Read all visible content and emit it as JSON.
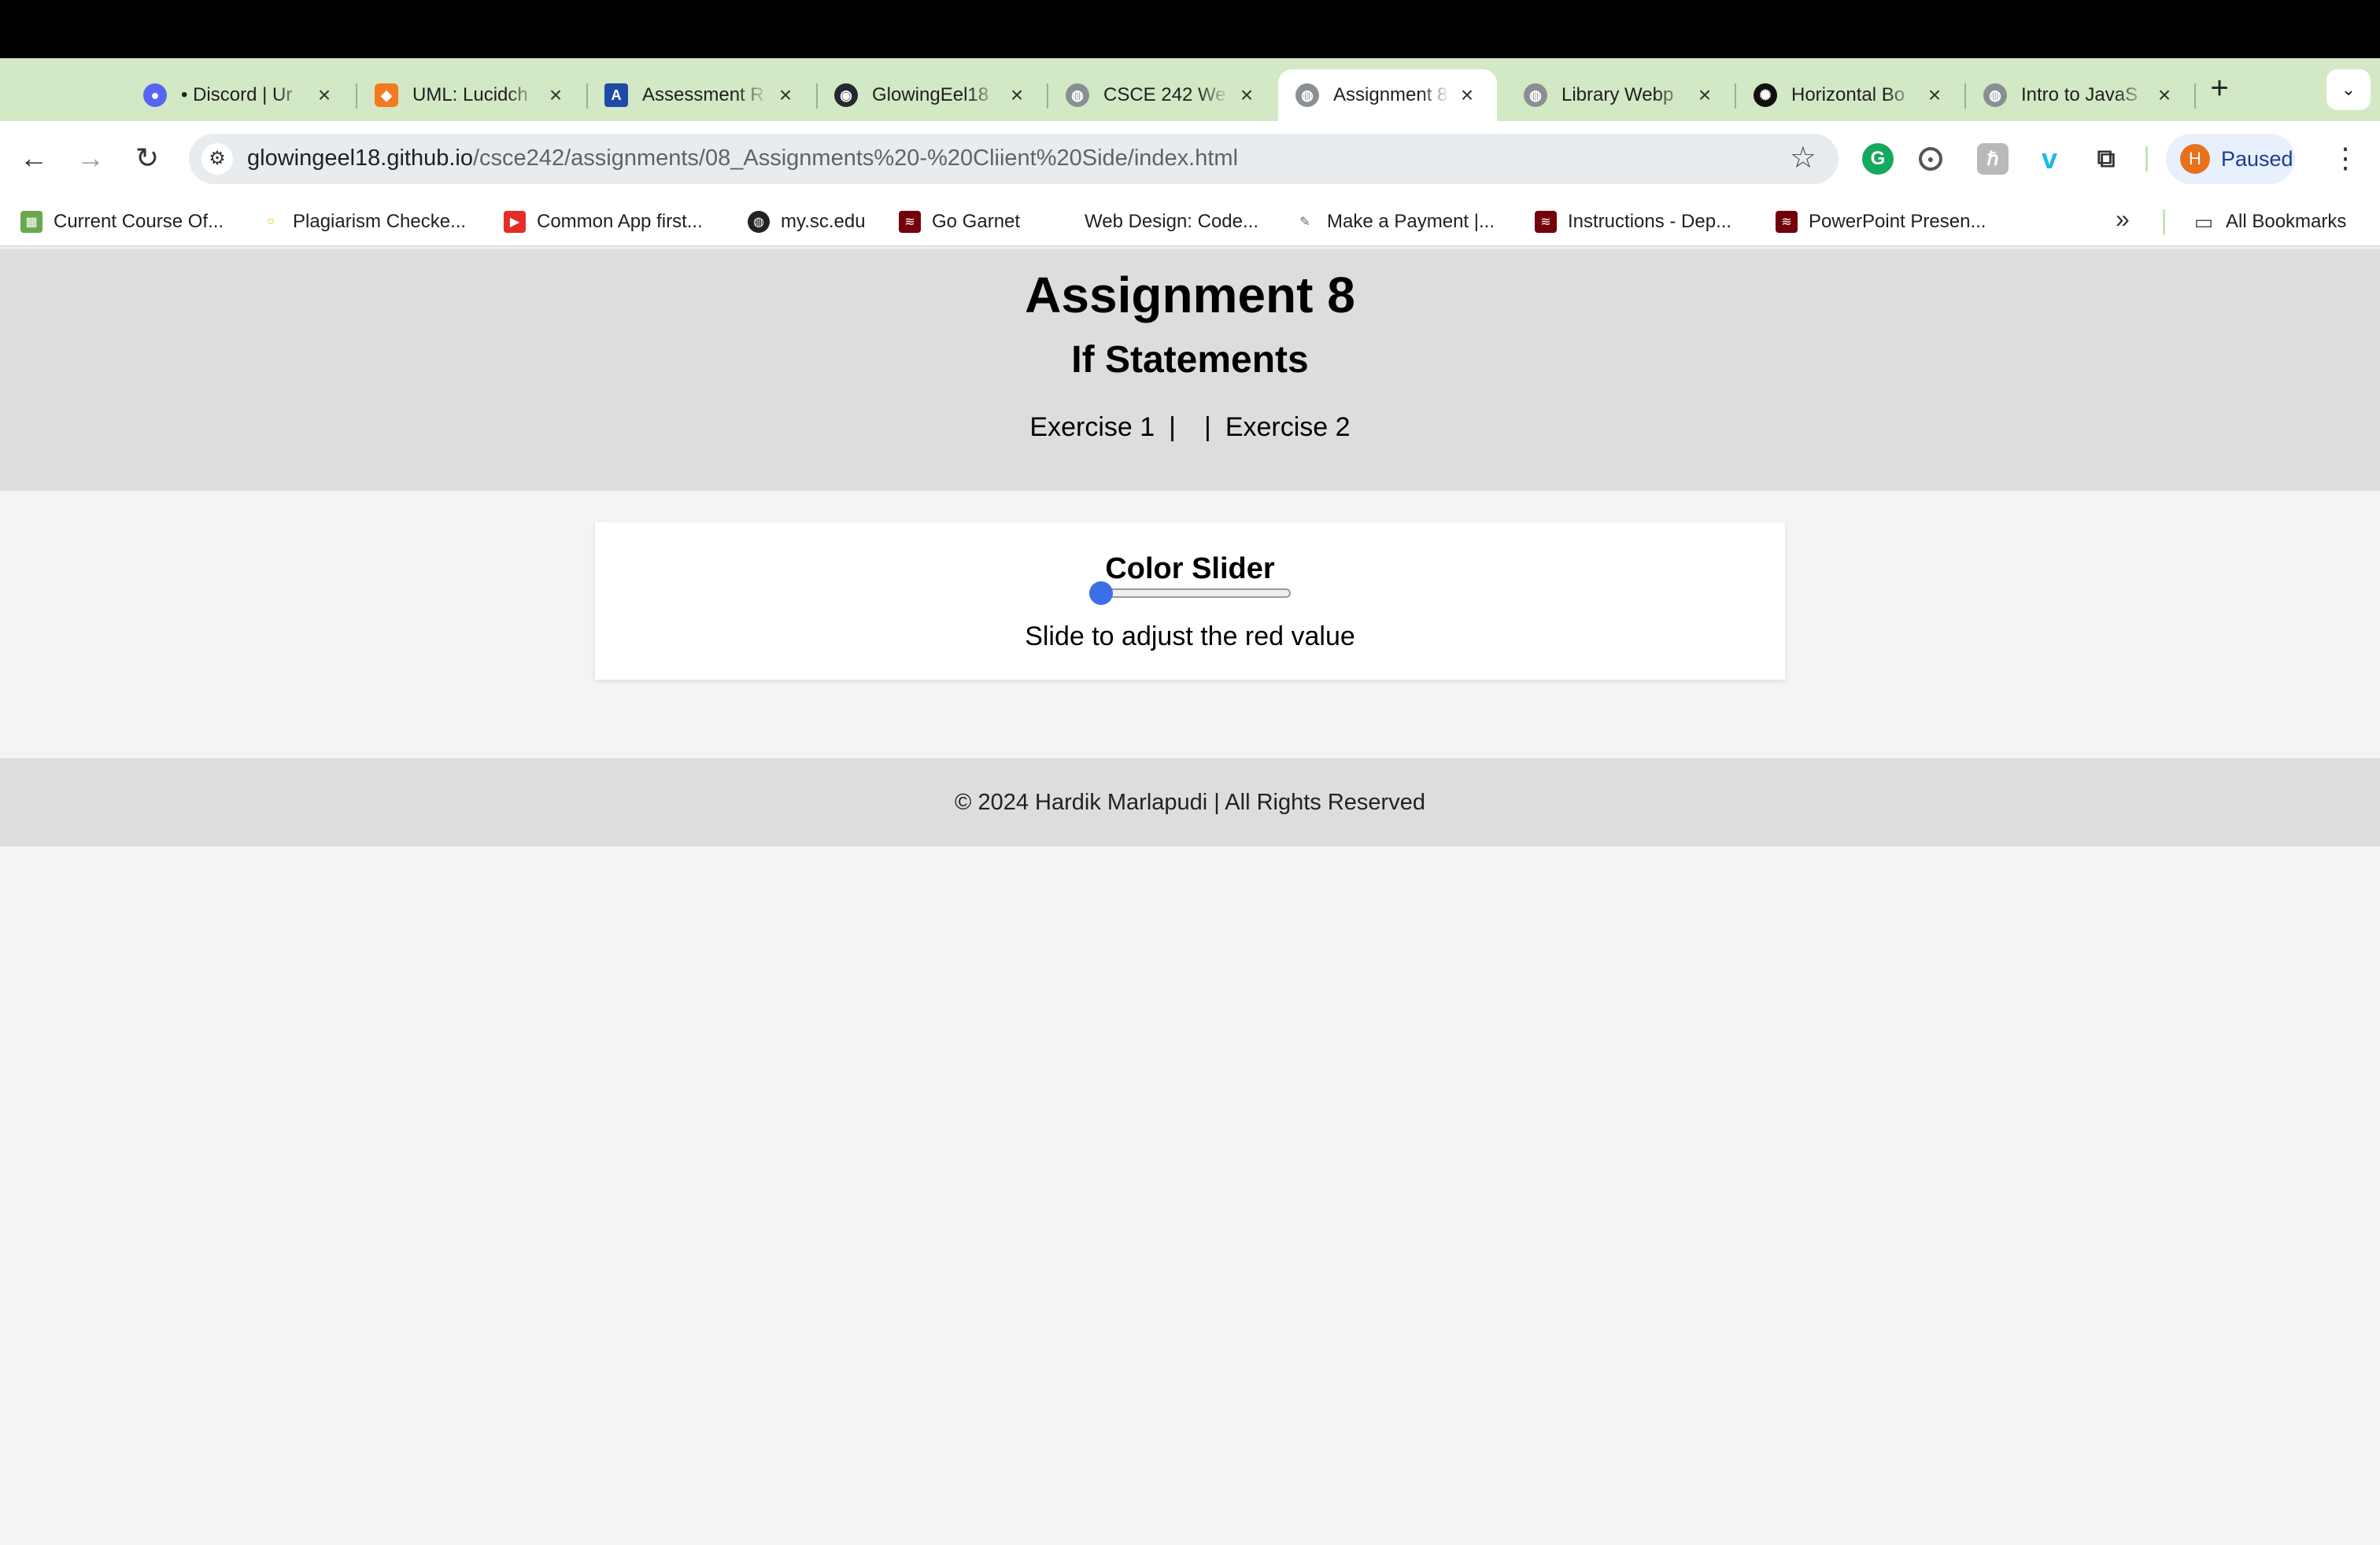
{
  "browser": {
    "tabs": [
      {
        "title": "• Discord | Ur",
        "icon": "discord-icon",
        "active": false
      },
      {
        "title": "UML: Lucidch",
        "icon": "lucidchart-icon",
        "active": false
      },
      {
        "title": "Assessment R",
        "icon": "assessment-icon",
        "active": false
      },
      {
        "title": "GlowingEel18",
        "icon": "github-icon",
        "active": false
      },
      {
        "title": "CSCE 242 We",
        "icon": "globe-icon",
        "active": false
      },
      {
        "title": "Assignment 8",
        "icon": "globe-icon",
        "active": true
      },
      {
        "title": "Library Webp",
        "icon": "globe-icon",
        "active": false
      },
      {
        "title": "Horizontal Bo",
        "icon": "chatgpt-icon",
        "active": false
      },
      {
        "title": "Intro to JavaS",
        "icon": "globe-icon",
        "active": false
      }
    ],
    "new_tab": "+",
    "tab_search": "⌄",
    "url_host": "glowingeel18.github.io",
    "url_path": "/csce242/assignments/08_Assignments%20-%20Cliient%20Side/index.html",
    "profile_initial": "H",
    "profile_status": "Paused",
    "bookmarks": [
      {
        "label": "Current Course Of...",
        "icon": "course-icon"
      },
      {
        "label": "Plagiarism Checke...",
        "icon": "bulb-icon"
      },
      {
        "label": "Common App first...",
        "icon": "youtube-icon"
      },
      {
        "label": "my.sc.edu",
        "icon": "globe-icon"
      },
      {
        "label": "Go Garnet",
        "icon": "usc-icon"
      },
      {
        "label": "Web Design: Code...",
        "icon": "blank-icon"
      },
      {
        "label": "Make a Payment |...",
        "icon": "payment-icon"
      },
      {
        "label": "Instructions - Dep...",
        "icon": "usc-icon"
      },
      {
        "label": "PowerPoint Presen...",
        "icon": "usc-icon"
      }
    ],
    "bookmarks_more": "»",
    "all_bookmarks": "All Bookmarks",
    "colors": {
      "tabstrip": "#d3e8c4",
      "profile_accent": "#1a3f8f",
      "avatar": "#e8711c"
    }
  },
  "page": {
    "title": "Assignment 8",
    "subtitle": "If Statements",
    "nav": {
      "exercise1": "Exercise 1",
      "separator1": "|",
      "separator2": "|",
      "exercise2": "Exercise 2"
    },
    "card": {
      "heading": "Color Slider",
      "slider_value": 0,
      "caption": "Slide to adjust the red value"
    },
    "footer": "© 2024 Hardik Marlapudi | All Rights Reserved",
    "colors": {
      "header_bg": "#dddddd",
      "body_bg": "#f4f4f4",
      "slider": "#3b6fe8"
    }
  }
}
